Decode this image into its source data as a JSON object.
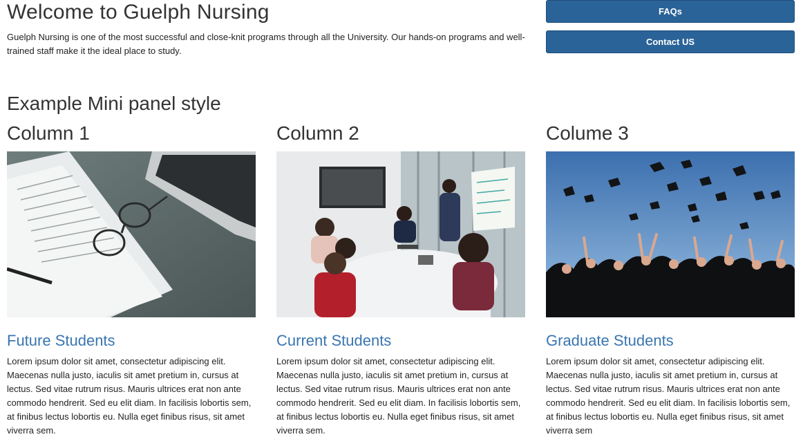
{
  "intro": {
    "title": "Welcome to Guelph Nursing",
    "text": "Guelph Nursing is one of the most successful and close-knit programs through all the University. Our hands-on programs and well-trained staff make it the ideal place to study."
  },
  "buttons": {
    "faqs_label": "FAQs",
    "contact_label": "Contact US"
  },
  "colors": {
    "button_bg": "#2a6397",
    "link": "#3a75b0"
  },
  "section": {
    "title": "Example Mini panel style"
  },
  "columns": [
    {
      "heading": "Column 1",
      "link": "Future Students",
      "text": "Lorem ipsum dolor sit amet, consectetur adipiscing elit. Maecenas nulla justo, iaculis sit amet pretium in, cursus at lectus. Sed vitae rutrum risus. Mauris ultrices erat non ante commodo hendrerit. Sed eu elit diam. In facilisis lobortis sem, at finibus lectus lobortis eu. Nulla eget finibus risus, sit amet viverra sem."
    },
    {
      "heading": "Column 2",
      "link": "Current Students",
      "text": "Lorem ipsum dolor sit amet, consectetur adipiscing elit. Maecenas nulla justo, iaculis sit amet pretium in, cursus at lectus. Sed vitae rutrum risus. Mauris ultrices erat non ante commodo hendrerit. Sed eu elit diam. In facilisis lobortis sem, at finibus lectus lobortis eu. Nulla eget finibus risus, sit amet viverra sem."
    },
    {
      "heading": "Colume 3",
      "link": "Graduate Students",
      "text": "Lorem ipsum dolor sit amet, consectetur adipiscing elit. Maecenas nulla justo, iaculis sit amet pretium in, cursus at lectus. Sed vitae rutrum risus. Mauris ultrices erat non ante commodo hendrerit. Sed eu elit diam. In facilisis lobortis sem, at finibus lectus lobortis eu. Nulla eget finibus risus, sit amet viverra sem"
    }
  ]
}
